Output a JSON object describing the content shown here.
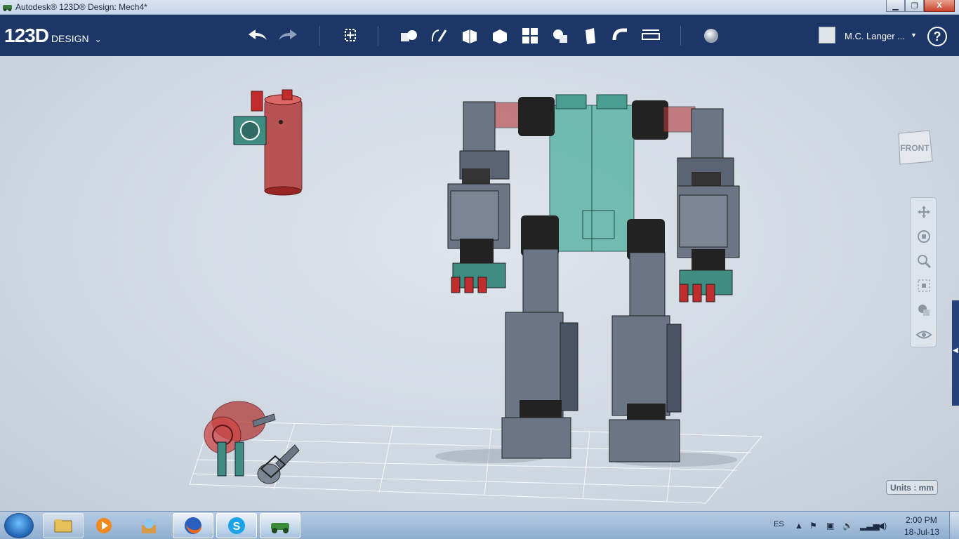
{
  "window": {
    "title": "Autodesk® 123D® Design: Mech4*",
    "minimize": "▁",
    "maximize": "❐",
    "close": "X"
  },
  "brand": {
    "number": "123D",
    "word": "DESIGN",
    "chevron": "⌄"
  },
  "toolbar": {
    "tools": [
      "undo-icon",
      "redo-icon",
      "transform-icon",
      "primitives-icon",
      "sketch-icon",
      "construct-icon",
      "modify-icon",
      "pattern-icon",
      "group-icon",
      "combine-icon",
      "snap-icon",
      "measure-icon",
      "material-icon"
    ]
  },
  "user": {
    "name": "M.C. Langer ...",
    "dropdown": "▼",
    "help": "?"
  },
  "viewcube": {
    "face": "FRONT"
  },
  "navigation": [
    "pan-icon",
    "orbit-icon",
    "zoom-icon",
    "fit-icon",
    "view-style-icon",
    "visibility-icon"
  ],
  "units_label": "Units : mm",
  "taskbar": {
    "apps": [
      "explorer-icon",
      "media-player-icon",
      "app-icon",
      "firefox-icon",
      "skype-icon",
      "123d-design-icon"
    ],
    "language": "ES",
    "time": "2:00 PM",
    "date": "18-Jul-13"
  },
  "colors": {
    "toolbar": "#1c3767",
    "robot_gray": "#6b7585",
    "robot_teal": "#5fb5a6",
    "robot_red": "#c12c2c"
  }
}
